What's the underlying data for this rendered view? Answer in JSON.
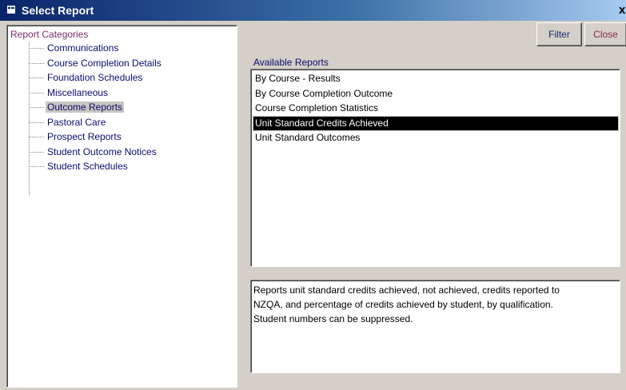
{
  "window": {
    "title": "Select Report",
    "close_glyph": "x"
  },
  "categories": {
    "root_label": "Report Categories",
    "items": [
      {
        "label": "Communications"
      },
      {
        "label": "Course Completion Details"
      },
      {
        "label": "Foundation Schedules"
      },
      {
        "label": "Miscellaneous"
      },
      {
        "label": "Outcome Reports",
        "selected": true
      },
      {
        "label": "Pastoral Care"
      },
      {
        "label": "Prospect Reports"
      },
      {
        "label": "Student Outcome Notices"
      },
      {
        "label": "Student Schedules"
      }
    ]
  },
  "buttons": {
    "filter": "Filter",
    "close": "Close"
  },
  "reports": {
    "label": "Available Reports",
    "items": [
      {
        "label": "By Course - Results"
      },
      {
        "label": "By Course Completion Outcome"
      },
      {
        "label": "Course Completion Statistics"
      },
      {
        "label": "Unit Standard Credits Achieved",
        "selected": true
      },
      {
        "label": "Unit Standard Outcomes"
      }
    ]
  },
  "description": {
    "lines": [
      "Reports unit standard credits achieved, not achieved, credits reported to",
      "NZQA, and percentage of credits achieved by student, by qualification.",
      "Student numbers can be suppressed."
    ]
  },
  "colors": {
    "title_gradient_start": "#0a246a",
    "category_text": "#0b0b6e",
    "root_text": "#7a2d6e",
    "selection_bg": "#000000"
  }
}
